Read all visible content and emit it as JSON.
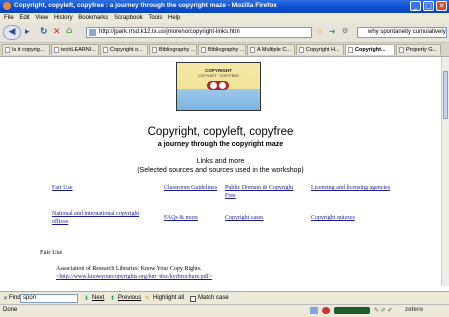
{
  "window": {
    "title": "Copyright, copyleft, copyfree : a journey through the copyright maze - Mozilla Firefox",
    "controls": [
      "_",
      "□",
      "✕"
    ]
  },
  "menu": [
    "File",
    "Edit",
    "View",
    "History",
    "Bookmarks",
    "Scrapbook",
    "Tools",
    "Help"
  ],
  "nav": {
    "back_icon": "back-arrow-icon",
    "url": "http://jpark.rrsd.k12.tx.us/jmoreno/copyright-links.htm",
    "search_text": "why spontaneity cumulatively"
  },
  "tabs": [
    {
      "label": "Is it copyrig..."
    },
    {
      "label": "techLEARNI..."
    },
    {
      "label": "Copyright o..."
    },
    {
      "label": "Bibliography ..."
    },
    {
      "label": "Bibliography ..."
    },
    {
      "label": "A Multiple C..."
    },
    {
      "label": "Copyright H..."
    },
    {
      "label": "Copyright..."
    },
    {
      "label": "Property G..."
    }
  ],
  "banner": {
    "title": "COPYRIGHT",
    "subtitle": "COPYLEFT · COPYFREE"
  },
  "page": {
    "title": "Copyright, copyleft, copyfree",
    "subtitle": "a journey through the copyright maze",
    "links_heading_1": "Links and more",
    "links_heading_2": "(Selected sources and sources used in the workshop)",
    "links": [
      "Fair Use",
      "Classroom Guidelines",
      "Public Domain & Copyright Free",
      "Licensing and licensing agencies",
      "National and international copyright offices",
      "FAQs & more",
      "Copyright cases",
      "Copyright quizzes"
    ],
    "section_title": "Fair Use",
    "entry_text": "Association of Research Libraries:  Know Your Copy Rights.",
    "entry_link": "<http://www.knowyourcopyrights.org/bm~doc/kyrbrochure.pdf>"
  },
  "findbar": {
    "close": "✕",
    "label": "Find:",
    "value": "spon",
    "next": "Next",
    "previous": "Previous",
    "highlight": "Highlight all",
    "match_case": "Match case"
  },
  "status": {
    "text": "Done",
    "extension": "zotero"
  }
}
